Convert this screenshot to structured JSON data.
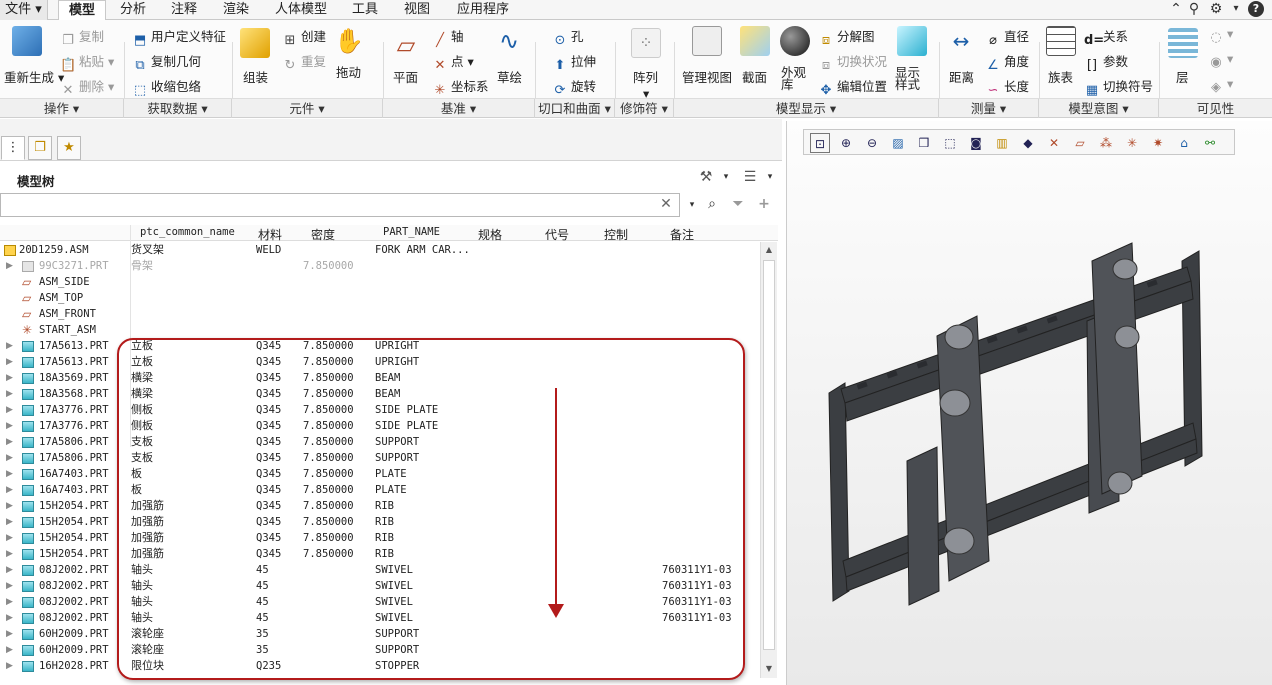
{
  "menu": {
    "file": "文件",
    "tabs": [
      "模型",
      "分析",
      "注释",
      "渲染",
      "人体模型",
      "工具",
      "视图",
      "应用程序"
    ],
    "active_tab": "模型"
  },
  "ribbon": {
    "regen": "重新生成",
    "copy": "复制",
    "paste": "粘贴",
    "delete": "删除",
    "udf": "用户定义特征",
    "copy_geom": "复制几何",
    "shrinkwrap": "收缩包络",
    "assemble": "组装",
    "create": "创建",
    "repeat": "重复",
    "drag": "拖动",
    "components": "元件",
    "plane": "平面",
    "axis": "轴",
    "point": "点",
    "csys": "坐标系",
    "sketch": "草绘",
    "hole": "孔",
    "extrude": "拉伸",
    "revolve": "旋转",
    "pattern": "阵列",
    "manage_views": "管理视图",
    "section": "截面",
    "appearance": "外观库",
    "explode": "分解图",
    "toggle_status": "切换状况",
    "edit_position": "编辑位置",
    "display_style": "显示样式",
    "distance": "距离",
    "diameter": "直径",
    "angle": "角度",
    "length": "长度",
    "family_table": "族表",
    "relations": "关系",
    "parameters": "参数",
    "switch_symbol": "切换符号",
    "layers": "层"
  },
  "groups": [
    "操作",
    "获取数据",
    "元件",
    "基准",
    "切口和曲面",
    "修饰符",
    "模型显示",
    "测量",
    "模型意图",
    "可见性"
  ],
  "tree": {
    "title": "模型树",
    "filter_value": "",
    "columns": [
      "ptc_common_name",
      "材料",
      "密度",
      "PART_NAME",
      "规格",
      "代号",
      "控制",
      "备注"
    ],
    "root": {
      "name": "20D1259.ASM",
      "common": "货叉架",
      "material": "WELD",
      "density": "",
      "part_name": "FORK ARM CAR...",
      "remark": ""
    },
    "rows": [
      {
        "name": "99C3271.PRT",
        "common": "骨架",
        "material": "",
        "density": "7.850000",
        "part_name": "",
        "remark": "",
        "icon": "grey",
        "muted": true
      },
      {
        "name": "ASM_SIDE",
        "common": "",
        "material": "",
        "density": "",
        "part_name": "",
        "remark": "",
        "icon": "datum"
      },
      {
        "name": "ASM_TOP",
        "common": "",
        "material": "",
        "density": "",
        "part_name": "",
        "remark": "",
        "icon": "datum"
      },
      {
        "name": "ASM_FRONT",
        "common": "",
        "material": "",
        "density": "",
        "part_name": "",
        "remark": "",
        "icon": "datum"
      },
      {
        "name": "START_ASM",
        "common": "",
        "material": "",
        "density": "",
        "part_name": "",
        "remark": "",
        "icon": "csys"
      },
      {
        "name": "17A5613.PRT",
        "common": "立板",
        "material": "Q345",
        "density": "7.850000",
        "part_name": "UPRIGHT",
        "remark": ""
      },
      {
        "name": "17A5613.PRT",
        "common": "立板",
        "material": "Q345",
        "density": "7.850000",
        "part_name": "UPRIGHT",
        "remark": ""
      },
      {
        "name": "18A3569.PRT",
        "common": "横梁",
        "material": "Q345",
        "density": "7.850000",
        "part_name": "BEAM",
        "remark": ""
      },
      {
        "name": "18A3568.PRT",
        "common": "横梁",
        "material": "Q345",
        "density": "7.850000",
        "part_name": "BEAM",
        "remark": ""
      },
      {
        "name": "17A3776.PRT",
        "common": "侧板",
        "material": "Q345",
        "density": "7.850000",
        "part_name": "SIDE PLATE",
        "remark": ""
      },
      {
        "name": "17A3776.PRT",
        "common": "侧板",
        "material": "Q345",
        "density": "7.850000",
        "part_name": "SIDE PLATE",
        "remark": ""
      },
      {
        "name": "17A5806.PRT",
        "common": "支板",
        "material": "Q345",
        "density": "7.850000",
        "part_name": "SUPPORT",
        "remark": ""
      },
      {
        "name": "17A5806.PRT",
        "common": "支板",
        "material": "Q345",
        "density": "7.850000",
        "part_name": "SUPPORT",
        "remark": ""
      },
      {
        "name": "16A7403.PRT",
        "common": "板",
        "material": "Q345",
        "density": "7.850000",
        "part_name": "PLATE",
        "remark": ""
      },
      {
        "name": "16A7403.PRT",
        "common": "板",
        "material": "Q345",
        "density": "7.850000",
        "part_name": "PLATE",
        "remark": ""
      },
      {
        "name": "15H2054.PRT",
        "common": "加强筋",
        "material": "Q345",
        "density": "7.850000",
        "part_name": "RIB",
        "remark": ""
      },
      {
        "name": "15H2054.PRT",
        "common": "加强筋",
        "material": "Q345",
        "density": "7.850000",
        "part_name": "RIB",
        "remark": ""
      },
      {
        "name": "15H2054.PRT",
        "common": "加强筋",
        "material": "Q345",
        "density": "7.850000",
        "part_name": "RIB",
        "remark": ""
      },
      {
        "name": "15H2054.PRT",
        "common": "加强筋",
        "material": "Q345",
        "density": "7.850000",
        "part_name": "RIB",
        "remark": ""
      },
      {
        "name": "08J2002.PRT",
        "common": "轴头",
        "material": "45",
        "density": "",
        "part_name": "SWIVEL",
        "remark": "760311Y1-03"
      },
      {
        "name": "08J2002.PRT",
        "common": "轴头",
        "material": "45",
        "density": "",
        "part_name": "SWIVEL",
        "remark": "760311Y1-03"
      },
      {
        "name": "08J2002.PRT",
        "common": "轴头",
        "material": "45",
        "density": "",
        "part_name": "SWIVEL",
        "remark": "760311Y1-03"
      },
      {
        "name": "08J2002.PRT",
        "common": "轴头",
        "material": "45",
        "density": "",
        "part_name": "SWIVEL",
        "remark": "760311Y1-03"
      },
      {
        "name": "60H2009.PRT",
        "common": "滚轮座",
        "material": "35",
        "density": "",
        "part_name": "SUPPORT",
        "remark": ""
      },
      {
        "name": "60H2009.PRT",
        "common": "滚轮座",
        "material": "35",
        "density": "",
        "part_name": "SUPPORT",
        "remark": ""
      },
      {
        "name": "16H2028.PRT",
        "common": "限位块",
        "material": "Q235",
        "density": "",
        "part_name": "STOPPER",
        "remark": ""
      }
    ]
  },
  "colors": {
    "accent": "#b31b1b",
    "model": "#3b3e42"
  }
}
